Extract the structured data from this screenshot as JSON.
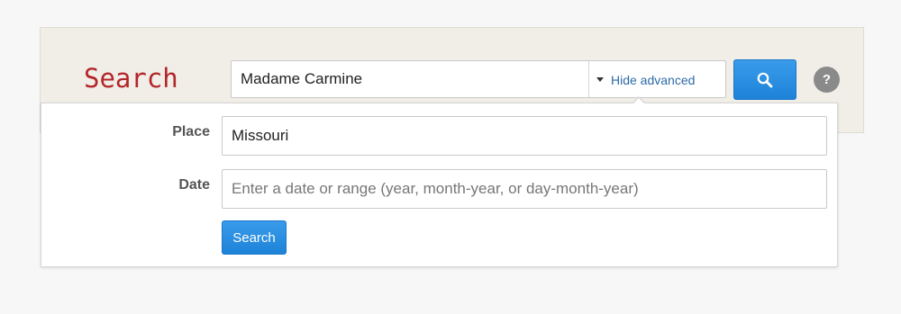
{
  "header": {
    "title": "Search"
  },
  "search": {
    "query_value": "Madame Carmine",
    "toggle_label": "Hide advanced",
    "help_label": "?"
  },
  "advanced": {
    "place_label": "Place",
    "place_value": "Missouri",
    "date_label": "Date",
    "date_placeholder": "Enter a date or range (year, month-year, or day-month-year)",
    "submit_label": "Search"
  },
  "icons": {
    "search_button": "search-icon",
    "toggle": "caret-down-icon",
    "help": "help-icon"
  },
  "colors": {
    "title": "#b3262a",
    "accent": "#2d8fe2",
    "link": "#2c6aa8",
    "bar_background": "#f1eee7"
  }
}
